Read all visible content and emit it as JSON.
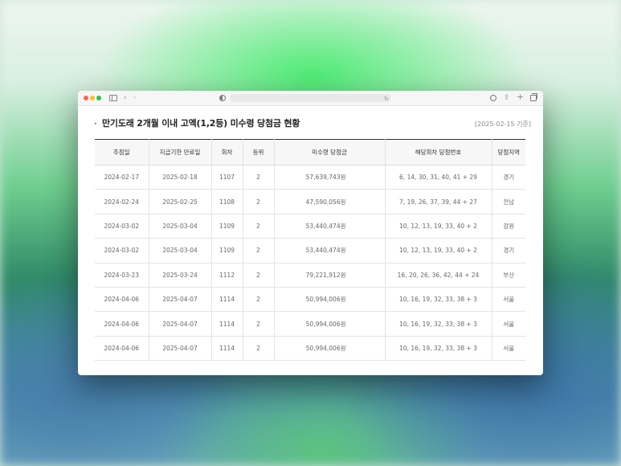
{
  "page": {
    "title": "만기도래 2개월 이내 고액(1,2등) 미수령 당첨금 현황",
    "date_note": "[2025-02-15 기준]"
  },
  "table": {
    "headers": [
      "추첨일",
      "지급기한 만료일",
      "회차",
      "등위",
      "미수령 당첨금",
      "해당회차 당첨번호",
      "당첨지역"
    ],
    "rows": [
      [
        "2024-02-17",
        "2025-02-18",
        "1107",
        "2",
        "57,639,743원",
        "6, 14, 30, 31, 40, 41 + 29",
        "경기"
      ],
      [
        "2024-02-24",
        "2025-02-25",
        "1108",
        "2",
        "47,590,056원",
        "7, 19, 26, 37, 39, 44 + 27",
        "전남"
      ],
      [
        "2024-03-02",
        "2025-03-04",
        "1109",
        "2",
        "53,440,474원",
        "10, 12, 13, 19, 33, 40 + 2",
        "강원"
      ],
      [
        "2024-03-02",
        "2025-03-04",
        "1109",
        "2",
        "53,440,474원",
        "10, 12, 13, 19, 33, 40 + 2",
        "경기"
      ],
      [
        "2024-03-23",
        "2025-03-24",
        "1112",
        "2",
        "79,221,912원",
        "16, 20, 26, 36, 42, 44 + 24",
        "부산"
      ],
      [
        "2024-04-06",
        "2025-04-07",
        "1114",
        "2",
        "50,994,006원",
        "10, 16, 19, 32, 33, 38 + 3",
        "서울"
      ],
      [
        "2024-04-06",
        "2025-04-07",
        "1114",
        "2",
        "50,994,006원",
        "10, 16, 19, 32, 33, 38 + 3",
        "서울"
      ],
      [
        "2024-04-06",
        "2025-04-07",
        "1114",
        "2",
        "50,994,006원",
        "10, 16, 19, 32, 33, 38 + 3",
        "서울"
      ]
    ]
  },
  "icons": {
    "reload": "↻",
    "back": "‹",
    "forward": "›",
    "share": "⇪",
    "new_tab": "+"
  }
}
